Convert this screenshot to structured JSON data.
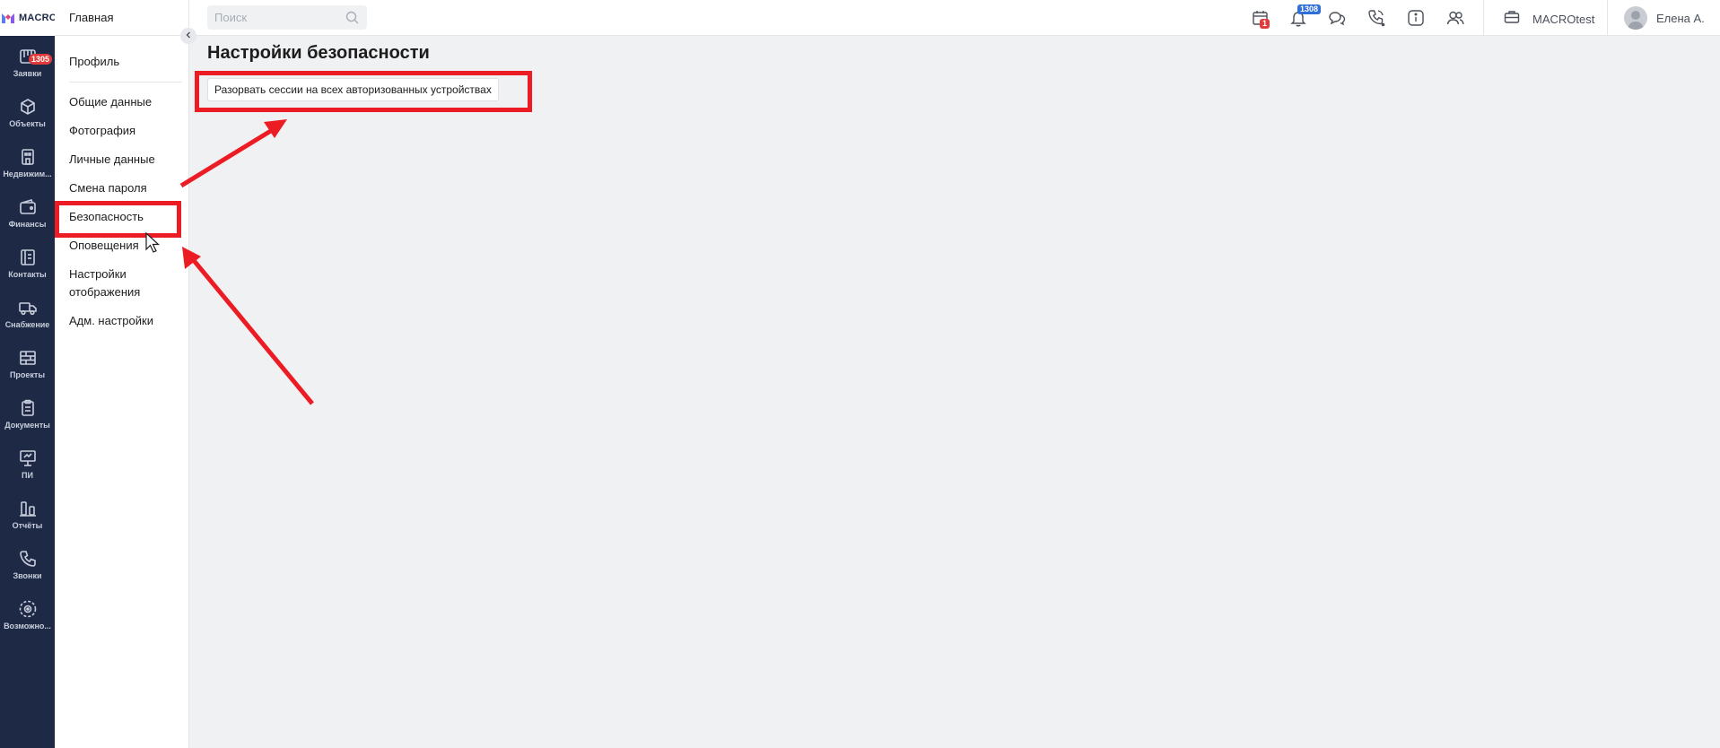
{
  "logo": {
    "text": "MACRO"
  },
  "rail": {
    "items": [
      {
        "label": "Заявки",
        "icon": "requests-icon",
        "badge": "1305"
      },
      {
        "label": "Объекты",
        "icon": "cube-icon"
      },
      {
        "label": "Недвижим...",
        "icon": "building-icon"
      },
      {
        "label": "Финансы",
        "icon": "wallet-icon"
      },
      {
        "label": "Контакты",
        "icon": "contacts-book-icon"
      },
      {
        "label": "Снабжение",
        "icon": "truck-icon"
      },
      {
        "label": "Проекты",
        "icon": "wall-icon"
      },
      {
        "label": "Документы",
        "icon": "clipboard-icon"
      },
      {
        "label": "ПИ",
        "icon": "presentation-board-icon"
      },
      {
        "label": "Отчёты",
        "icon": "bar-chart-icon"
      },
      {
        "label": "Звонки",
        "icon": "phone-icon"
      },
      {
        "label": "Возможно...",
        "icon": "gear-circle-icon"
      }
    ]
  },
  "submenu": {
    "title": "Главная",
    "items": [
      {
        "label": "Профиль"
      },
      {
        "label": "Общие данные"
      },
      {
        "label": "Фотография"
      },
      {
        "label": "Личные данные"
      },
      {
        "label": "Смена пароля"
      },
      {
        "label": "Безопасность",
        "active": true
      },
      {
        "label": "Оповещения"
      },
      {
        "label": "Настройки отображения"
      },
      {
        "label": "Адм. настройки"
      }
    ]
  },
  "topbar": {
    "search_placeholder": "Поиск",
    "calendar_badge": "1",
    "notifications_badge": "1308",
    "company": "MACROtest",
    "user_name": "Елена А."
  },
  "main": {
    "title": "Настройки безопасности",
    "action_button": "Разорвать сессии на всех авторизованных устройствах"
  },
  "colors": {
    "rail_bg": "#1e2a45",
    "annotation_red": "#ec1c24",
    "badge_red": "#e23a3a",
    "badge_blue": "#2f6fd6",
    "page_bg": "#f0f1f3"
  }
}
